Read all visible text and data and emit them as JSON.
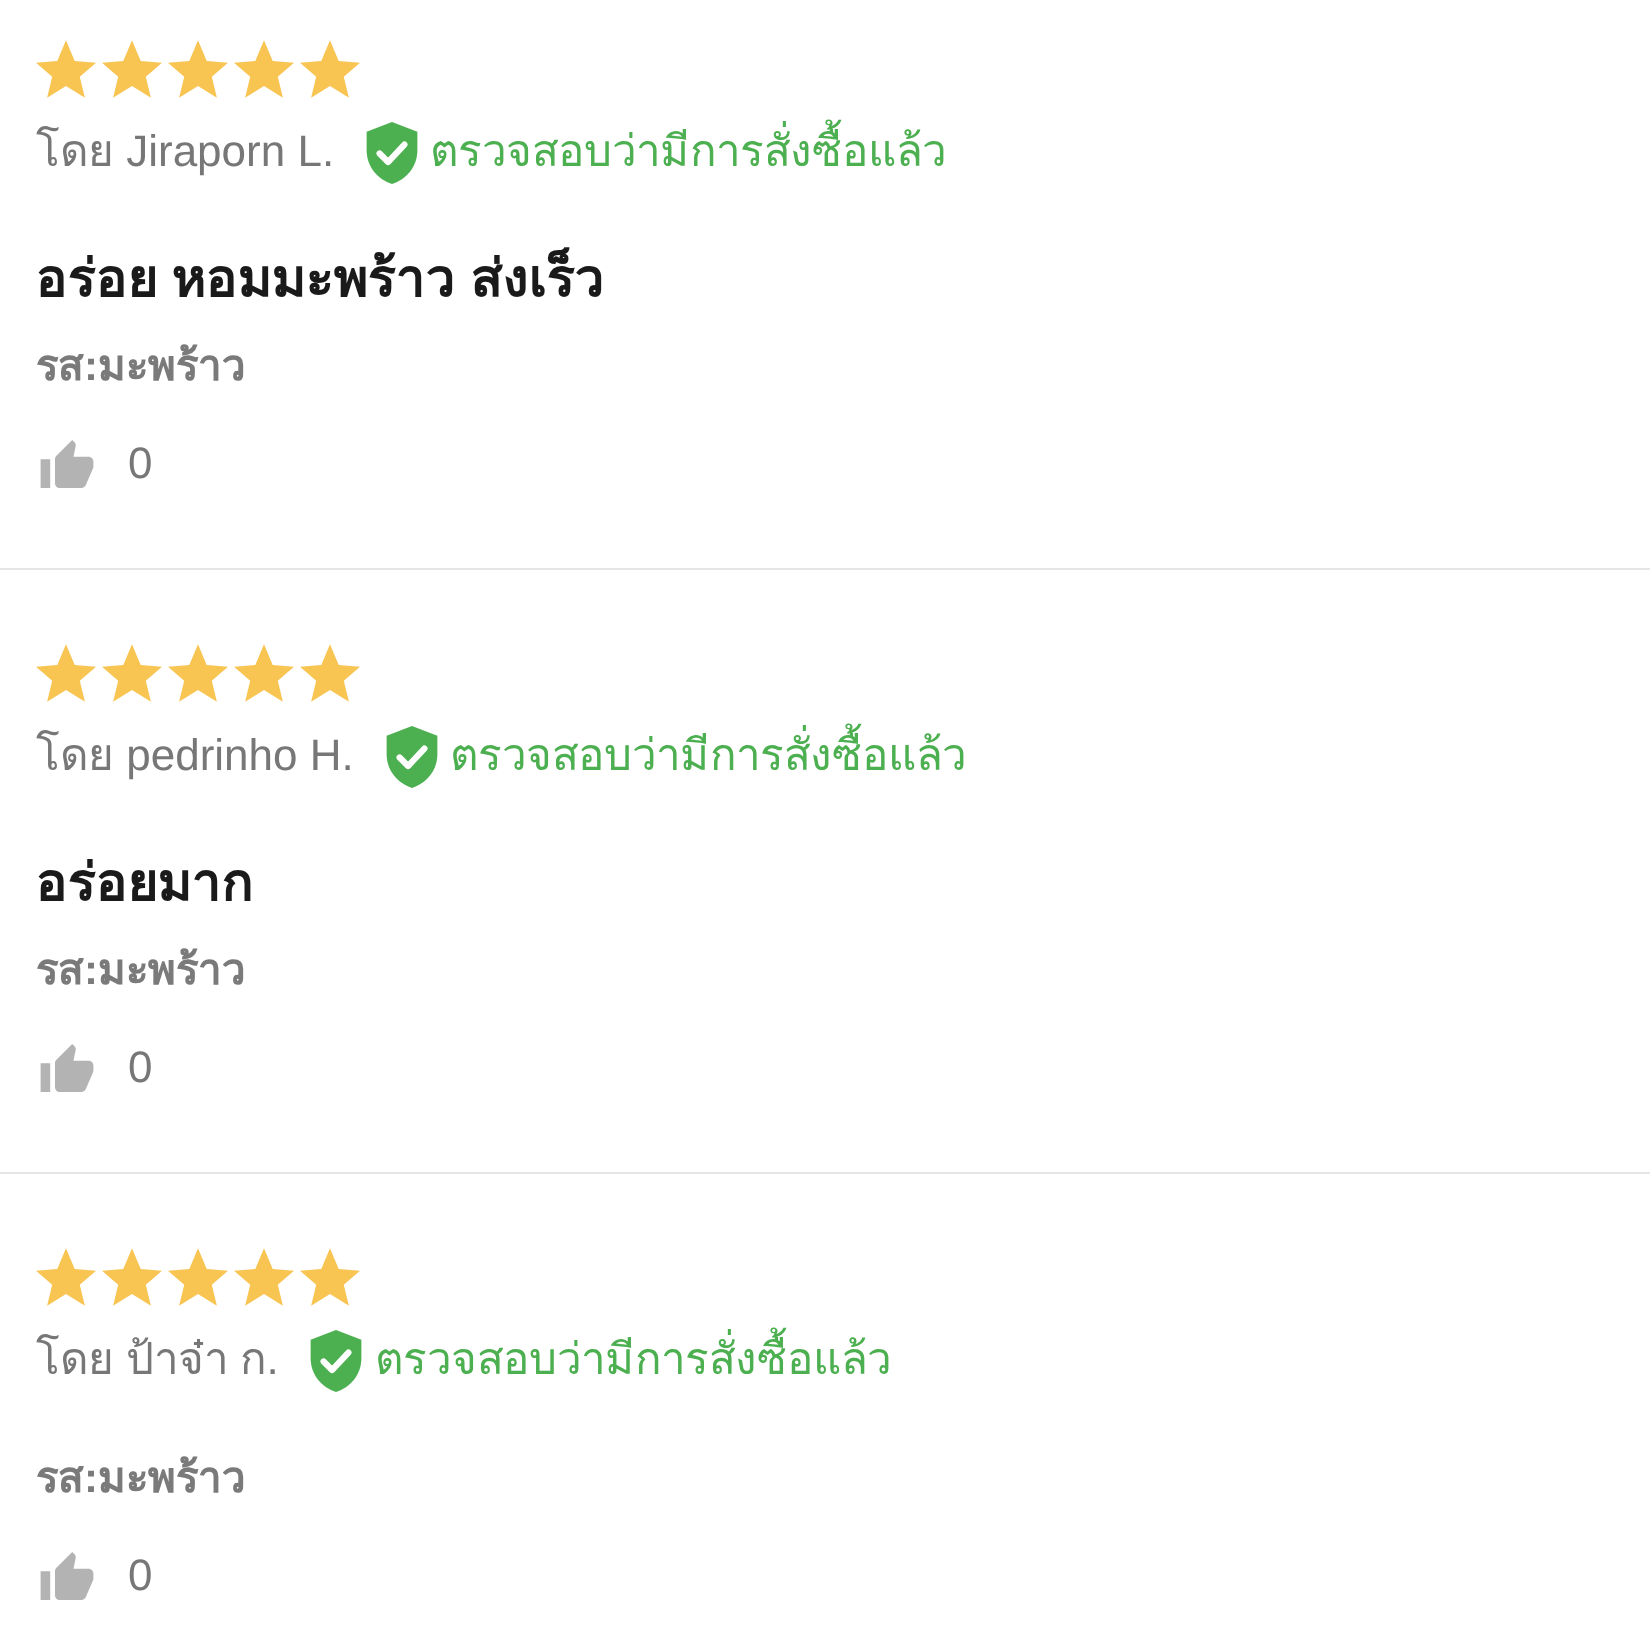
{
  "reviews": [
    {
      "stars": 5,
      "author": "โดย Jiraporn L.",
      "verified_badge": "ตรวจสอบว่ามีการสั่งซื้อแล้ว",
      "title": "อร่อย หอมมะพร้าว ส่งเร็ว",
      "flavor": "รส:มะพร้าว",
      "likes": "0"
    },
    {
      "stars": 5,
      "author": "โดย pedrinho H.",
      "verified_badge": "ตรวจสอบว่ามีการสั่งซื้อแล้ว",
      "title": "อร่อยมาก",
      "flavor": "รส:มะพร้าว",
      "likes": "0"
    },
    {
      "stars": 5,
      "author": "โดย ป้าจ๋า ก.",
      "verified_badge": "ตรวจสอบว่ามีการสั่งซื้อแล้ว",
      "flavor": "รส:มะพร้าว",
      "likes": "0"
    }
  ]
}
